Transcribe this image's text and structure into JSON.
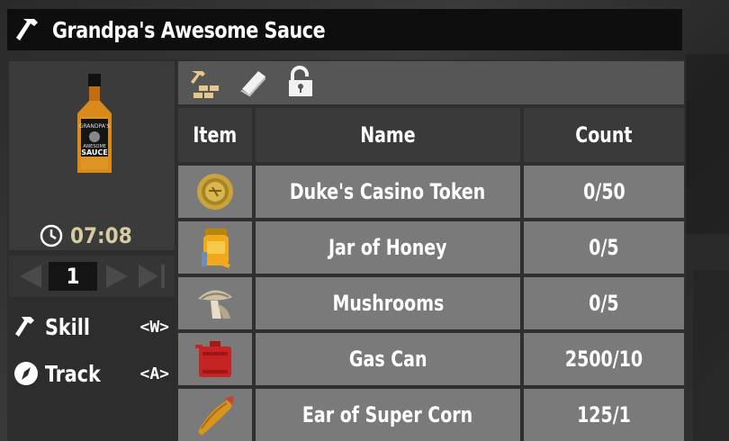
{
  "title": "Grandpa's Awesome Sauce",
  "item": {
    "bottle_label_top": "GRANDPA'S",
    "bottle_label_mid": "AWESOME",
    "bottle_label_bottom": "SAUCE"
  },
  "timer": "07:08",
  "quantity": "1",
  "actions": [
    {
      "label": "Skill",
      "key": "<W>",
      "icon": "hammer-icon"
    },
    {
      "label": "Track",
      "key": "<A>",
      "icon": "compass-icon"
    }
  ],
  "toolbar": [
    "hammer-bricks-icon",
    "book-icon",
    "unlock-icon"
  ],
  "table": {
    "headers": {
      "item": "Item",
      "name": "Name",
      "count": "Count"
    },
    "rows": [
      {
        "icon": "casino-token-icon",
        "name": "Duke's Casino Token",
        "count": "0/50"
      },
      {
        "icon": "honey-jar-icon",
        "name": "Jar of Honey",
        "count": "0/5"
      },
      {
        "icon": "mushroom-icon",
        "name": "Mushrooms",
        "count": "0/5"
      },
      {
        "icon": "gas-can-icon",
        "name": "Gas Can",
        "count": "2500/10"
      },
      {
        "icon": "super-corn-icon",
        "name": "Ear of Super Corn",
        "count": "125/1"
      }
    ]
  },
  "colors": {
    "timer": "#d8cba2",
    "cell": "#7a7a7a",
    "header": "#3a3a3a",
    "titlebar": "#0e0e0e"
  }
}
